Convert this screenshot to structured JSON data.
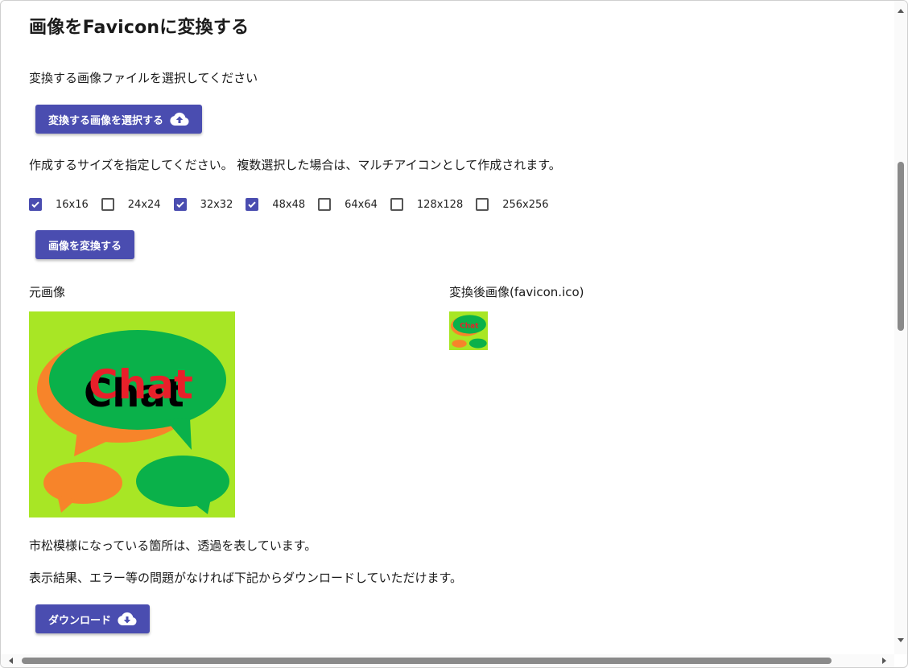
{
  "page": {
    "title": "画像をFaviconに変換する",
    "select_prompt": "変換する画像ファイルを選択してください",
    "select_button": "変換する画像を選択する",
    "size_prompt": "作成するサイズを指定してください。 複数選択した場合は、マルチアイコンとして作成されます。",
    "sizes": [
      {
        "label": "16x16",
        "checked": true
      },
      {
        "label": "24x24",
        "checked": false
      },
      {
        "label": "32x32",
        "checked": true
      },
      {
        "label": "48x48",
        "checked": true
      },
      {
        "label": "64x64",
        "checked": false
      },
      {
        "label": "128x128",
        "checked": false
      },
      {
        "label": "256x256",
        "checked": false
      }
    ],
    "convert_button": "画像を変換する",
    "original_label": "元画像",
    "converted_label": "変換後画像(favicon.ico)",
    "transparency_note": "市松模様になっている箇所は、透過を表しています。",
    "download_note": "表示結果、エラー等の問題がなければ下記からダウンロードしていただけます。",
    "download_button": "ダウンロード",
    "image_text": "Chat"
  },
  "colors": {
    "accent": "#4a4db0",
    "image_background": "#a8e625",
    "bubble_green": "#0ab14a",
    "bubble_orange": "#f7842a",
    "chat_red": "#e8202a"
  }
}
